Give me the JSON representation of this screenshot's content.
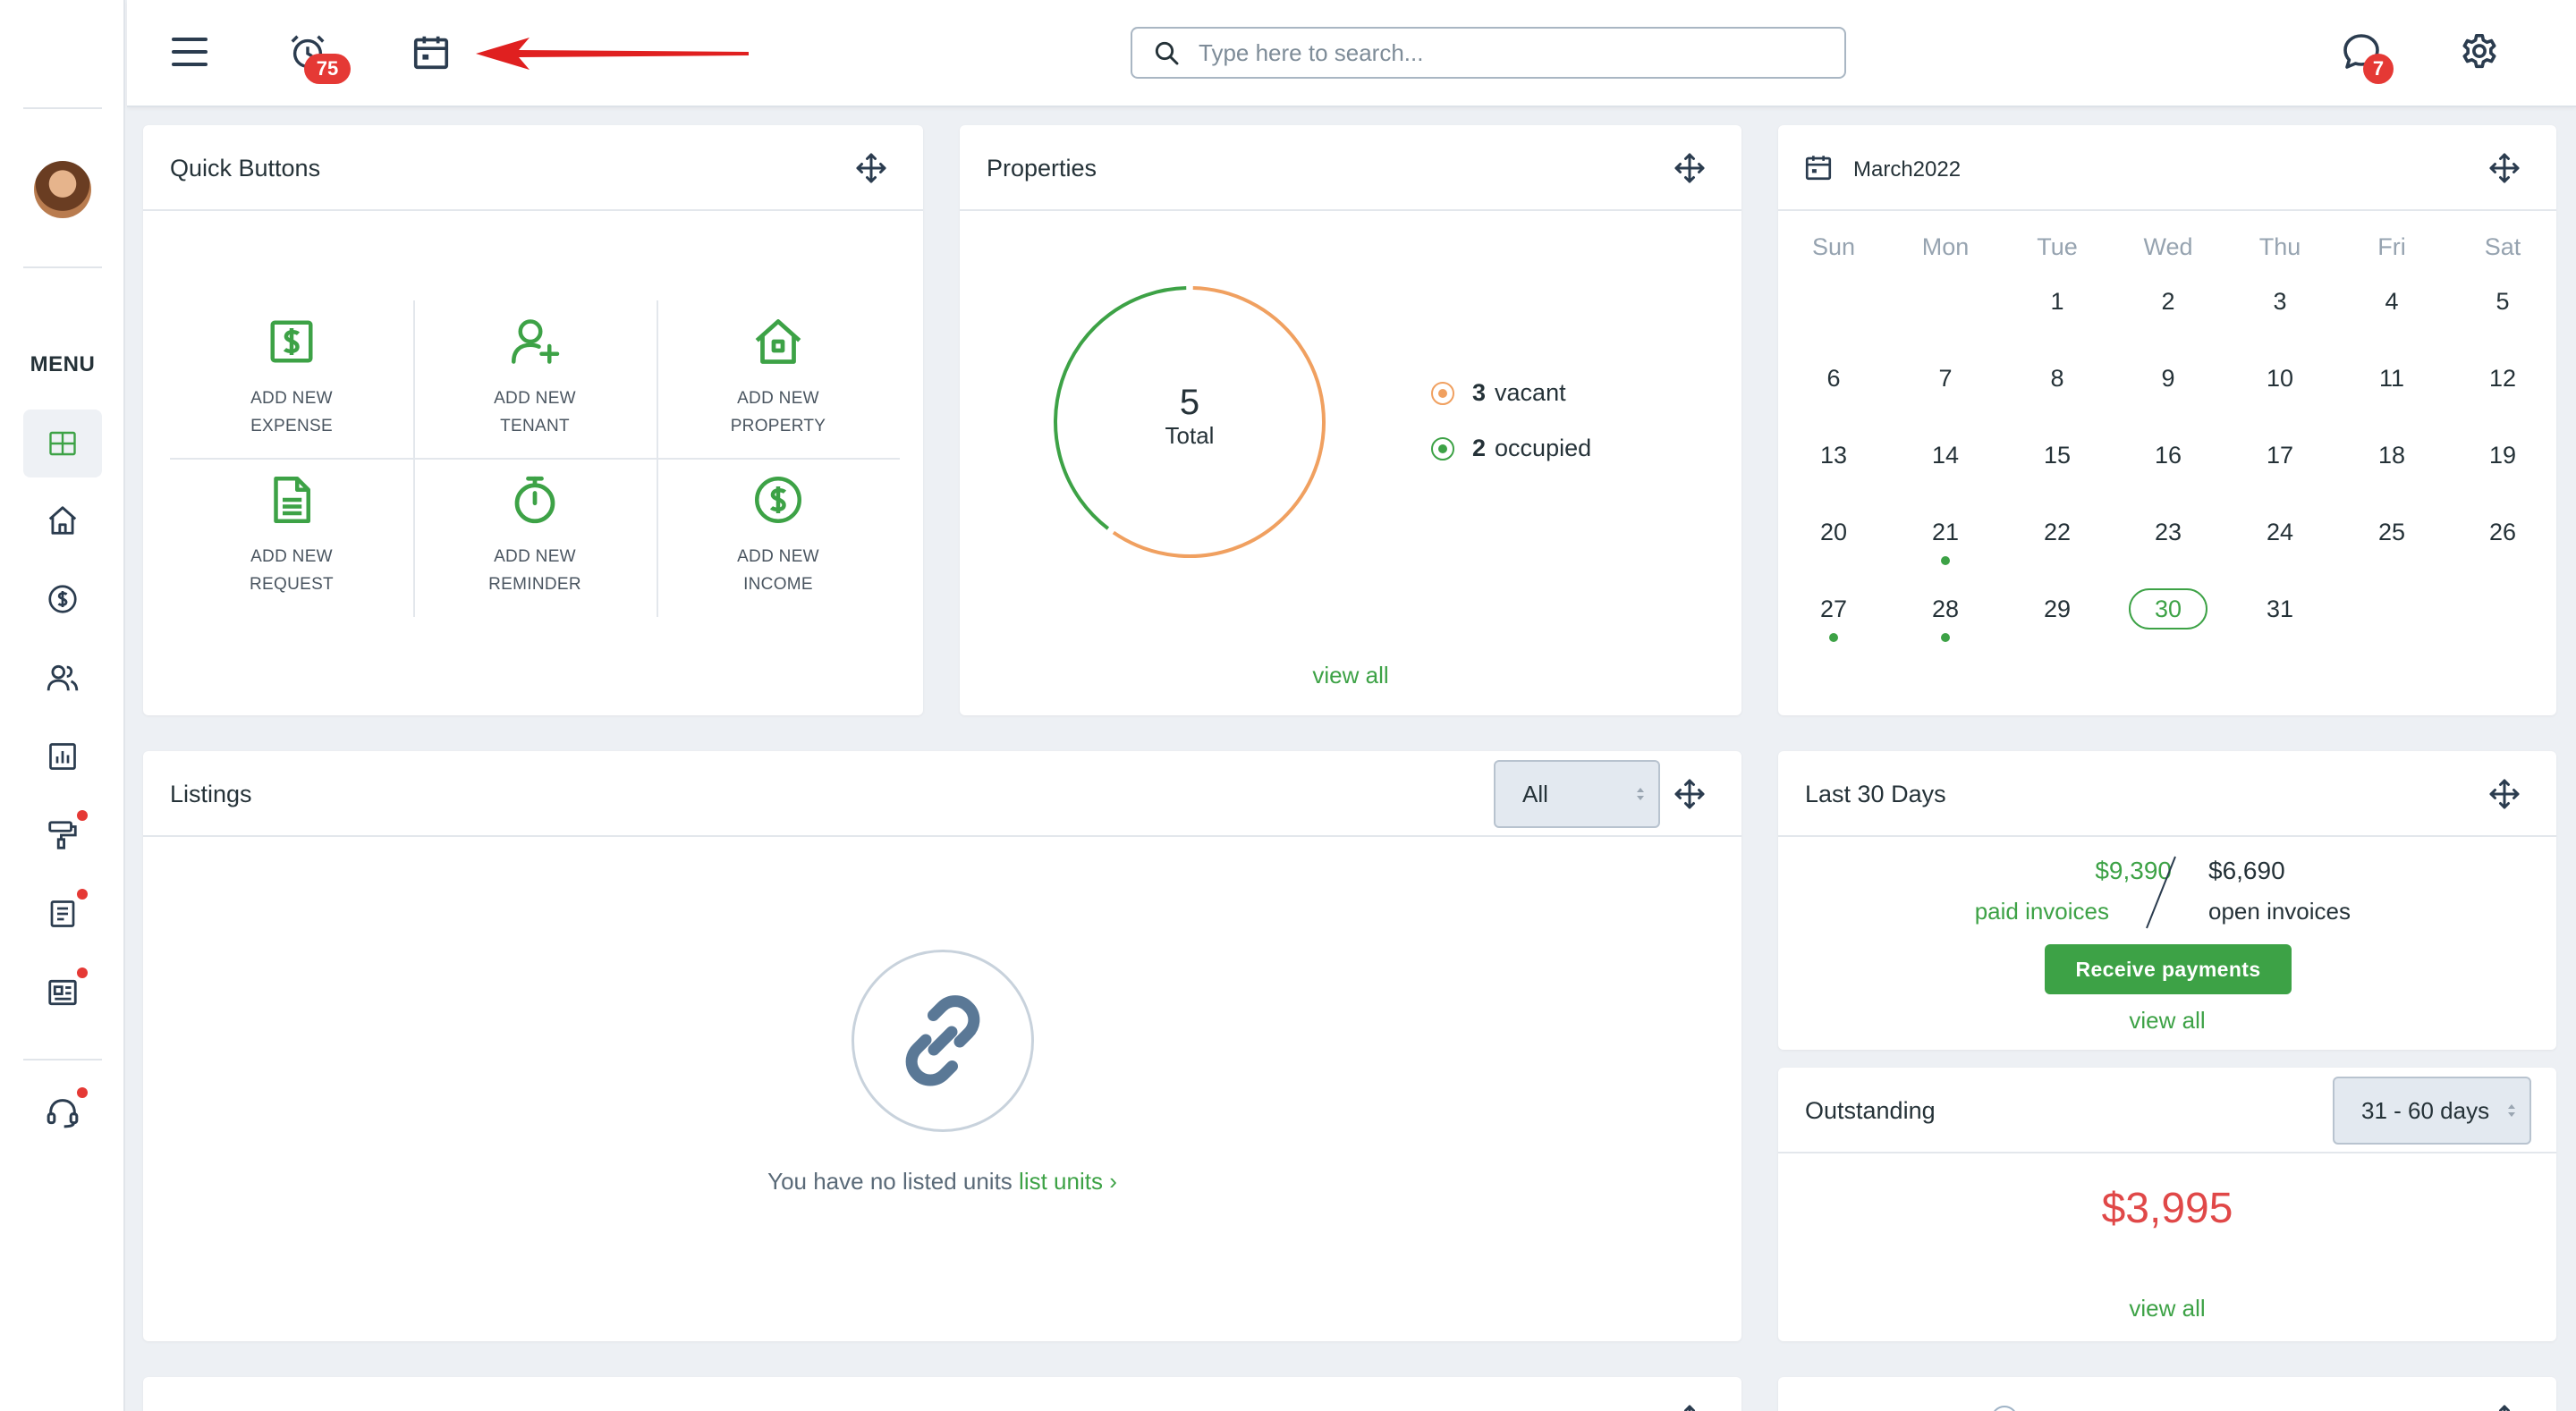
{
  "topbar": {
    "alarm_badge": "75",
    "chat_badge": "7",
    "search_placeholder": "Type here to search..."
  },
  "sidebar": {
    "menu_label": "MENU",
    "items": [
      {
        "icon": "dashboard-icon",
        "active": true
      },
      {
        "icon": "home-icon"
      },
      {
        "icon": "dollar-icon"
      },
      {
        "icon": "users-icon"
      },
      {
        "icon": "chart-icon"
      },
      {
        "icon": "paint-roller-icon",
        "dot": true
      },
      {
        "icon": "document-icon",
        "dot": true
      },
      {
        "icon": "newspaper-icon",
        "dot": true
      },
      {
        "icon": "headset-icon",
        "dot": true
      }
    ]
  },
  "quick_buttons": {
    "title": "Quick Buttons",
    "buttons": [
      {
        "line1": "ADD NEW",
        "line2": "EXPENSE",
        "icon": "expense-icon"
      },
      {
        "line1": "ADD NEW",
        "line2": "TENANT",
        "icon": "add-user-icon"
      },
      {
        "line1": "ADD NEW",
        "line2": "PROPERTY",
        "icon": "house-icon"
      },
      {
        "line1": "ADD NEW",
        "line2": "REQUEST",
        "icon": "request-doc-icon"
      },
      {
        "line1": "ADD NEW",
        "line2": "REMINDER",
        "icon": "stopwatch-icon"
      },
      {
        "line1": "ADD NEW",
        "line2": "INCOME",
        "icon": "income-dollar-icon"
      }
    ]
  },
  "properties": {
    "title": "Properties",
    "total_value": "5",
    "total_label": "Total",
    "vacant_count": "3",
    "vacant_label": "vacant",
    "occupied_count": "2",
    "occupied_label": "occupied",
    "view_all": "view all",
    "colors": {
      "vacant": "#f0a060",
      "occupied": "#3da246"
    }
  },
  "calendar": {
    "month_label": "March2022",
    "weekdays": [
      "Sun",
      "Mon",
      "Tue",
      "Wed",
      "Thu",
      "Fri",
      "Sat"
    ],
    "first_weekday_index": 2,
    "days_in_month": 31,
    "today": 30,
    "event_days": [
      21,
      27,
      28
    ]
  },
  "listings": {
    "title": "Listings",
    "filter_value": "All",
    "empty_text": "You have no listed units",
    "empty_link": "list units ›"
  },
  "last30": {
    "title": "Last 30 Days",
    "paid_amount": "$9,390",
    "paid_label": "paid invoices",
    "open_amount": "$6,690",
    "open_label": "open invoices",
    "receive_button": "Receive payments",
    "view_all": "view all"
  },
  "outstanding": {
    "title": "Outstanding",
    "range_value": "31 - 60 days",
    "amount": "$3,995",
    "view_all": "view all"
  }
}
